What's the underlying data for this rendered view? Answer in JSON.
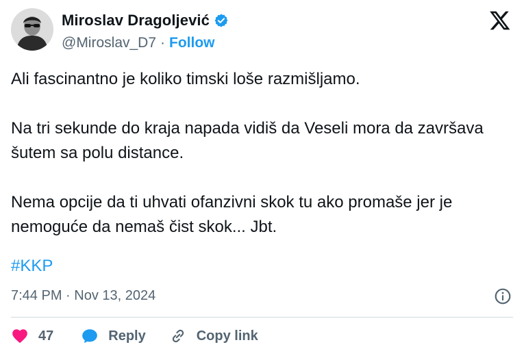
{
  "author": {
    "display_name": "Miroslav Dragoljević",
    "handle": "@Miroslav_D7",
    "separator": "·",
    "follow_label": "Follow"
  },
  "tweet": {
    "paragraphs": [
      "Ali fascinantno je koliko timski loše razmišljamo.",
      "Na tri sekunde do kraja napada vidiš da Veseli mora da završava šutem sa polu distance.",
      "Nema opcije da ti uhvati ofanzivni skok tu ako promaše jer je nemoguće da nemaš čist skok... Jbt."
    ],
    "hashtag": "#KKP",
    "timestamp": "7:44 PM · Nov 13, 2024"
  },
  "actions": {
    "like_count": "47",
    "reply_label": "Reply",
    "copy_link_label": "Copy link"
  },
  "icons": {
    "verified": "verified-badge-icon",
    "logo": "x-logo-icon",
    "info": "info-icon",
    "like": "heart-icon",
    "reply": "speech-bubble-icon",
    "copy": "link-icon"
  },
  "colors": {
    "accent": "#1d9bf0",
    "like": "#f91880",
    "muted": "#536471",
    "text": "#0f1419"
  }
}
